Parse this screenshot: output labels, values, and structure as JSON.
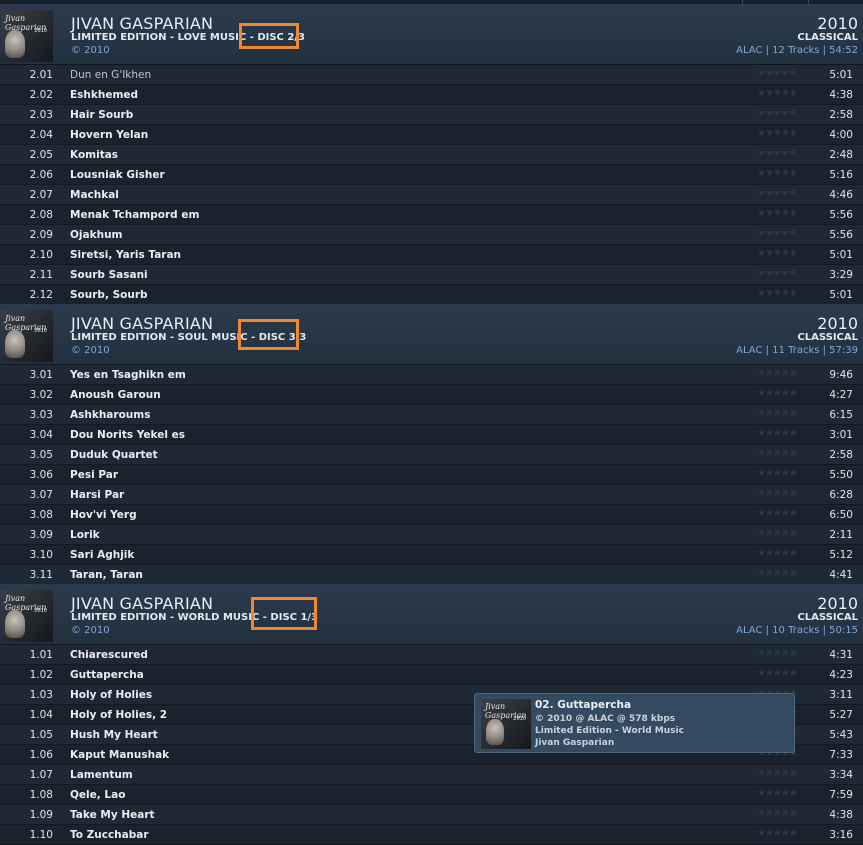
{
  "groups": [
    {
      "artist": "JIVAN GASPARIAN",
      "album": "LIMITED EDITION - LOVE MUSIC - ",
      "disc": "DISC 2/3",
      "copyright": "© 2010",
      "year": "2010",
      "genre": "CLASSICAL",
      "info": "ALAC | 12 Tracks | 54:52",
      "art_script": "Jivan Gasparian",
      "art_mini": "2010",
      "tracks": [
        {
          "num": "2.01",
          "title": "Dun en G'Ikhen",
          "dur": "5:01"
        },
        {
          "num": "2.02",
          "title": "Eshkhemed",
          "dur": "4:38"
        },
        {
          "num": "2.03",
          "title": "Hair Sourb",
          "dur": "2:58"
        },
        {
          "num": "2.04",
          "title": "Hovern Yelan",
          "dur": "4:00"
        },
        {
          "num": "2.05",
          "title": "Komitas",
          "dur": "2:48"
        },
        {
          "num": "2.06",
          "title": "Lousniak Gisher",
          "dur": "5:16"
        },
        {
          "num": "2.07",
          "title": "Machkal",
          "dur": "4:46"
        },
        {
          "num": "2.08",
          "title": "Menak Tchampord em",
          "dur": "5:56"
        },
        {
          "num": "2.09",
          "title": "Ojakhum",
          "dur": "5:56"
        },
        {
          "num": "2.10",
          "title": "Siretsi, Yaris Taran",
          "dur": "5:01"
        },
        {
          "num": "2.11",
          "title": "Sourb Sasani",
          "dur": "3:29"
        },
        {
          "num": "2.12",
          "title": "Sourb, Sourb",
          "dur": "5:01"
        }
      ]
    },
    {
      "artist": "JIVAN GASPARIAN",
      "album": "LIMITED EDITION - SOUL MUSIC - ",
      "disc": "DISC 3/3",
      "copyright": "© 2010",
      "year": "2010",
      "genre": "CLASSICAL",
      "info": "ALAC | 11 Tracks | 57:39",
      "art_script": "Jivan Gasparian",
      "art_mini": "2010",
      "tracks": [
        {
          "num": "3.01",
          "title": "Yes en Tsaghikn em",
          "dur": "9:46"
        },
        {
          "num": "3.02",
          "title": "Anoush Garoun",
          "dur": "4:27"
        },
        {
          "num": "3.03",
          "title": "Ashkharoums",
          "dur": "6:15"
        },
        {
          "num": "3.04",
          "title": "Dou Norits Yekel es",
          "dur": "3:01"
        },
        {
          "num": "3.05",
          "title": "Duduk Quartet",
          "dur": "2:58"
        },
        {
          "num": "3.06",
          "title": "Pesi Par",
          "dur": "5:50"
        },
        {
          "num": "3.07",
          "title": "Harsi Par",
          "dur": "6:28"
        },
        {
          "num": "3.08",
          "title": "Hov'vi Yerg",
          "dur": "6:50"
        },
        {
          "num": "3.09",
          "title": "Lorik",
          "dur": "2:11"
        },
        {
          "num": "3.10",
          "title": "Sari Aghjik",
          "dur": "5:12"
        },
        {
          "num": "3.11",
          "title": "Taran, Taran",
          "dur": "4:41"
        }
      ]
    },
    {
      "artist": "JIVAN GASPARIAN",
      "album": "LIMITED EDITION - WORLD MUSIC - ",
      "disc": "DISC 1/3",
      "copyright": "© 2010",
      "year": "2010",
      "genre": "CLASSICAL",
      "info": "ALAC | 10 Tracks | 50:15",
      "art_script": "Jivan Gasparian",
      "art_mini": "2010",
      "tracks": [
        {
          "num": "1.01",
          "title": "Chiarescured",
          "dur": "4:31"
        },
        {
          "num": "1.02",
          "title": "Guttapercha",
          "dur": "4:23"
        },
        {
          "num": "1.03",
          "title": "Holy of Holies",
          "dur": "3:11"
        },
        {
          "num": "1.04",
          "title": "Holy of Holies, 2",
          "dur": "5:27"
        },
        {
          "num": "1.05",
          "title": "Hush My Heart",
          "dur": "5:43"
        },
        {
          "num": "1.06",
          "title": "Kaput Manushak",
          "dur": "7:33"
        },
        {
          "num": "1.07",
          "title": "Lamentum",
          "dur": "3:34"
        },
        {
          "num": "1.08",
          "title": "Qele, Lao",
          "dur": "7:59"
        },
        {
          "num": "1.09",
          "title": "Take My Heart",
          "dur": "4:38"
        },
        {
          "num": "1.10",
          "title": "To Zucchabar",
          "dur": "3:16"
        }
      ]
    }
  ],
  "stars": "★★★★★",
  "tooltip": {
    "title": "02. Guttapercha",
    "line1": "© 2010 @ ALAC @ 578 kbps",
    "line2": "Limited Edition - World Music",
    "line3": "Jivan Gasparian",
    "art_script": "Jivan Gasparian",
    "art_mini": "2010"
  },
  "colors": {
    "highlight": "#f0892d",
    "link_blue": "#7fa8d6"
  }
}
